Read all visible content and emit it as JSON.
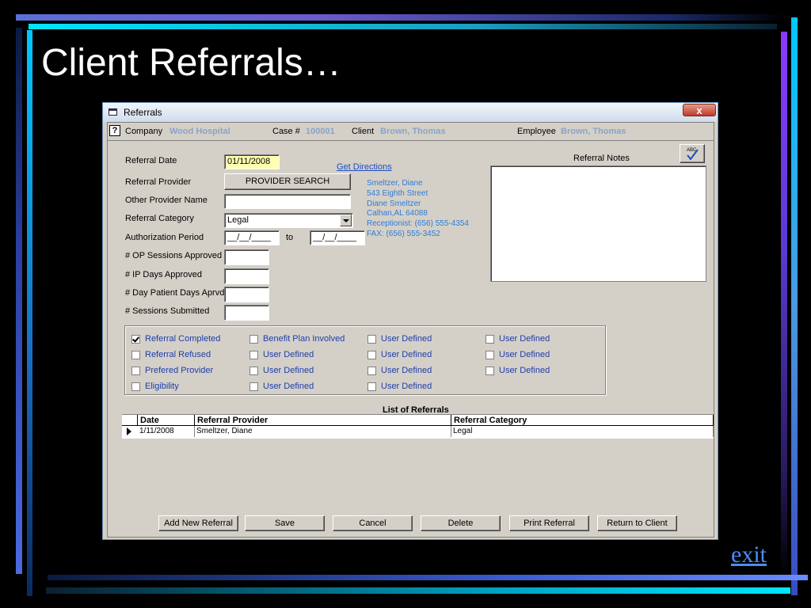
{
  "slide": {
    "title": "Client Referrals…",
    "exit_label": "exit"
  },
  "window": {
    "title": "Referrals",
    "close_label": "x"
  },
  "header": {
    "help_label": "?",
    "company_label": "Company",
    "company_value": "Wood Hospital",
    "case_label": "Case #",
    "case_value": "100001",
    "client_label": "Client",
    "client_value": "Brown, Thomas",
    "employee_label": "Employee",
    "employee_value": "Brown, Thomas"
  },
  "form": {
    "referral_date_label": "Referral Date",
    "referral_date_value": "01/11/2008",
    "get_directions": "Get Directions",
    "referral_provider_label": "Referral Provider",
    "provider_search_button": "PROVIDER SEARCH",
    "other_provider_label": "Other Provider Name",
    "other_provider_value": "",
    "referral_category_label": "Referral Category",
    "referral_category_value": "Legal",
    "auth_period_label": "Authorization Period",
    "auth_from_value": "__/__/____",
    "auth_to_label": "to",
    "auth_to_value": "__/__/____",
    "op_sessions_label": "# OP Sessions Approved",
    "ip_days_label": "# IP Days Approved",
    "day_patient_label": "# Day Patient Days Aprvd",
    "sessions_submitted_label": "# Sessions Submitted",
    "notes_label": "Referral Notes"
  },
  "provider_address": [
    "Smeltzer, Diane",
    "543 Eighth Street",
    "Diane Smeltzer",
    "Calhan,AL 64088",
    "Receptionist: (656) 555-4354",
    "FAX: (656) 555-3452"
  ],
  "checkboxes": [
    {
      "label": "Referral Completed",
      "checked": true
    },
    {
      "label": "Referral Refused",
      "checked": false
    },
    {
      "label": "Prefered Provider",
      "checked": false
    },
    {
      "label": "Eligibility",
      "checked": false
    },
    {
      "label": "Benefit Plan Involved",
      "checked": false
    },
    {
      "label": "User Defined",
      "checked": false
    },
    {
      "label": "User Defined",
      "checked": false
    },
    {
      "label": "User Defined",
      "checked": false
    },
    {
      "label": "User Defined",
      "checked": false
    },
    {
      "label": "User Defined",
      "checked": false
    },
    {
      "label": "User Defined",
      "checked": false
    },
    {
      "label": "User Defined",
      "checked": false
    },
    {
      "label": "User Defined",
      "checked": false
    },
    {
      "label": "User Defined",
      "checked": false
    },
    {
      "label": "User Defined",
      "checked": false
    }
  ],
  "referral_list": {
    "title": "List of Referrals",
    "columns": [
      "Date",
      "Referral Provider",
      "Referral Category"
    ],
    "rows": [
      [
        "1/11/2008",
        "Smeltzer, Diane",
        "Legal"
      ]
    ]
  },
  "buttons": {
    "add_new_referral": "Add New Referral",
    "save": "Save",
    "cancel": "Cancel",
    "delete": "Delete",
    "print_referral": "Print Referral",
    "return_to_client": "Return to Client"
  }
}
